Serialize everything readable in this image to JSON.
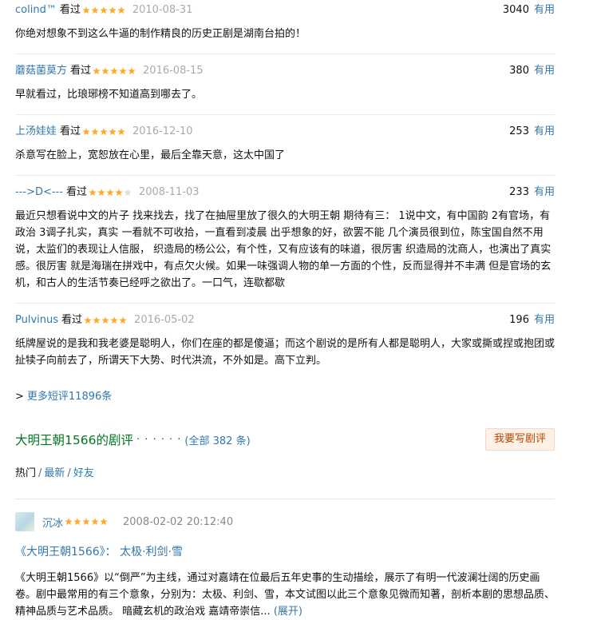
{
  "comments": [
    {
      "user": "colind™",
      "watched": "看过",
      "stars": 5,
      "date": "2010-08-31",
      "votes": "3040",
      "useful": "有用",
      "text": "你绝对想象不到这么牛逼的制作精良的历史正剧是湖南台拍的！"
    },
    {
      "user": "蘑菇菌莫方",
      "watched": "看过",
      "stars": 5,
      "date": "2016-08-15",
      "votes": "380",
      "useful": "有用",
      "text": "早就看过，比琅琊榜不知道高到哪去了。"
    },
    {
      "user": "上汤娃娃",
      "watched": "看过",
      "stars": 5,
      "date": "2016-12-10",
      "votes": "253",
      "useful": "有用",
      "text": "杀意写在脸上，宽恕放在心里，最后全靠天意，这太中国了"
    },
    {
      "user": "--->D<---",
      "watched": "看过",
      "stars": 4,
      "date": "2008-11-03",
      "votes": "233",
      "useful": "有用",
      "text": "最近只想看说中文的片子 找来找去，找了在抽屉里放了很久的大明王朝 期待有三： 1说中文，有中国韵 2有官场，有政治 3调子扎实，真实 一看就不可收拾，一直看到凌晨 出乎想象的好，欲罢不能 几个演员很到位，陈宝国自然不用说，太监们的表现让人信服， 织造局的杨公公，有个性，又有应该有的味道，很厉害 织造局的沈商人，也演出了真实感。很厉害 就是海瑞在拼戏中，有点欠火候。如果一味强调人物的单一方面的个性，反而显得并不丰满 但是官场的玄机，和古人的生活节奏已经呼之欲出了。一口气，连歇都歇"
    },
    {
      "user": "Pulvinus",
      "watched": "看过",
      "stars": 5,
      "date": "2016-05-02",
      "votes": "196",
      "useful": "有用",
      "text": "纸牌屋说的是我和我老婆是聪明人，你们在座的都是傻逼；而这个剧说的是所有人都是聪明人，大家或撕或捏或抱团或扯犊子向前去了，所谓天下大势、时代洪流，不外如是。高下立判。"
    }
  ],
  "more_short": {
    "prefix": ">",
    "label": "更多短评11896条"
  },
  "reviews_section": {
    "title": "大明王朝1566的剧评",
    "dots": "· · · · · ·",
    "count": "(全部 382 条)",
    "write_button": "我要写剧评",
    "filters": [
      "热门",
      "最新",
      "好友"
    ],
    "separator": "/"
  },
  "review": {
    "user": "沉冰",
    "stars": 5,
    "date": "2008-02-02 20:12:40",
    "title": "《大明王朝1566》： 太极·利剑·雪",
    "body": "《大明王朝1566》以“倒严”为主线，通过对嘉靖在位最后五年史事的生动描绘，展示了有明一代波澜壮阔的历史画卷。剧中最常用的有三个意象，分别为：太极、利剑、雪，本文试图以此三个意象见微而知著，剖析本剧的思想品质、精神品质与艺术品质。 暗藏玄机的政治戏 嘉靖帝崇信...",
    "expand": "(展开)"
  },
  "colors": {
    "link": "#3377aa",
    "star": "#ffac2d",
    "star_empty": "#dddddd",
    "green_title": "#007722",
    "button_bg": "#fff1e6",
    "button_text": "#bb4400"
  }
}
